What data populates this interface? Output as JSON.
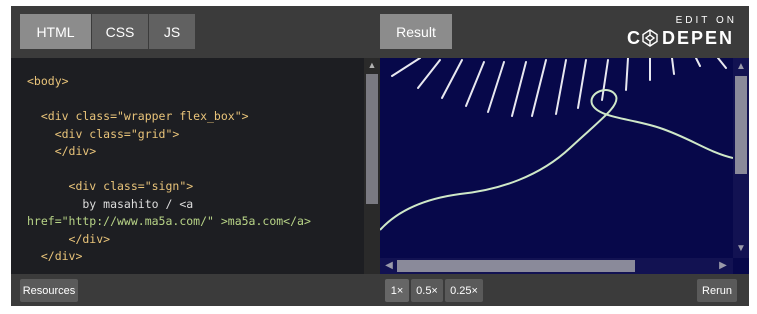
{
  "tabs": {
    "html": "HTML",
    "css": "CSS",
    "js": "JS",
    "result": "Result"
  },
  "brand": {
    "edit_on": "EDIT ON",
    "name": "C O DEPEN"
  },
  "code_lines": [
    "<body>",
    "",
    "  <div class=\"wrapper flex_box\">",
    "    <div class=\"grid\">",
    "    </div>",
    "",
    "      <div class=\"sign\">",
    "        by masahito / <a",
    "href=\"http://www.ma5a.com/\" >ma5a.com</a>",
    "      </div>",
    "  </div>"
  ],
  "bottom": {
    "resources": "Resources",
    "zoom_1": "1×",
    "zoom_05": "0.5×",
    "zoom_025": "0.25×",
    "rerun": "Rerun"
  },
  "colors": {
    "result_bg": "#07084a",
    "editor_bg": "#1d1e22",
    "tag": "#e9c47a",
    "string": "#b8d487"
  }
}
